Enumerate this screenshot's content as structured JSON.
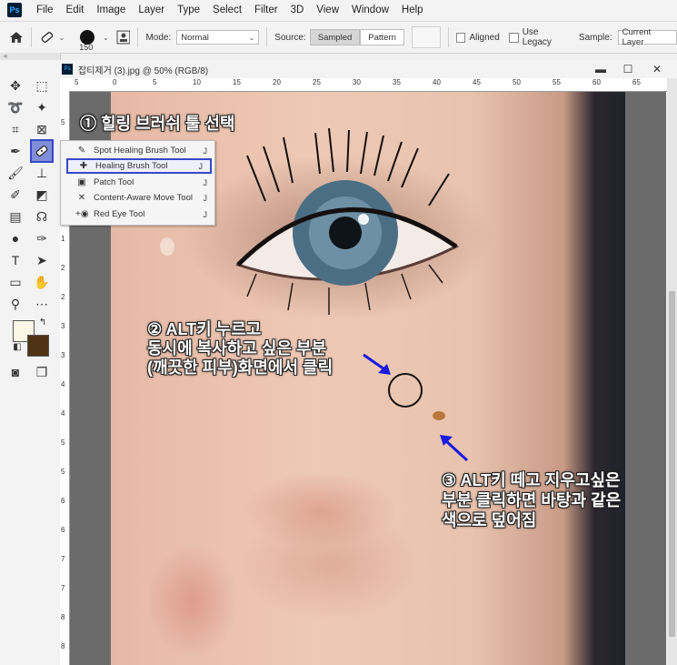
{
  "app": {
    "logo": "Ps"
  },
  "menu": [
    "File",
    "Edit",
    "Image",
    "Layer",
    "Type",
    "Select",
    "Filter",
    "3D",
    "View",
    "Window",
    "Help"
  ],
  "options": {
    "brush_size": "150",
    "mode_label": "Mode:",
    "mode_value": "Normal",
    "source_label": "Source:",
    "source_sampled": "Sampled",
    "source_pattern": "Pattern",
    "aligned": "Aligned",
    "use_legacy": "Use Legacy",
    "sample_label": "Sample:",
    "sample_value": "Current Layer"
  },
  "document": {
    "title": "잡티제거 (3).jpg @ 50% (RGB/8)",
    "win_minimize": "▬",
    "win_restore": "☐",
    "win_close": "✕"
  },
  "ruler_top": [
    "5",
    "0",
    "5",
    "10",
    "15",
    "20",
    "25",
    "30",
    "35",
    "40",
    "45",
    "50",
    "55",
    "60",
    "65"
  ],
  "ruler_left": [
    "5",
    "0",
    "5",
    "1",
    "1",
    "2",
    "2",
    "3",
    "3",
    "4",
    "4",
    "5",
    "5",
    "6",
    "6",
    "7",
    "7",
    "8",
    "8",
    "9",
    "9",
    "1",
    "1",
    "1"
  ],
  "flyout": [
    {
      "icon": "spot-healing-brush-icon",
      "glyph": "✎",
      "label": "Spot Healing Brush Tool",
      "key": "J"
    },
    {
      "icon": "healing-brush-icon",
      "glyph": "✚",
      "label": "Healing Brush Tool",
      "key": "J"
    },
    {
      "icon": "patch-icon",
      "glyph": "▣",
      "label": "Patch Tool",
      "key": "J"
    },
    {
      "icon": "content-aware-move-icon",
      "glyph": "✕",
      "label": "Content-Aware Move Tool",
      "key": "J"
    },
    {
      "icon": "red-eye-icon",
      "glyph": "+◉",
      "label": "Red Eye Tool",
      "key": "J"
    }
  ],
  "annotations": {
    "step1": "① 힐링 브러쉬 툴 선택",
    "step2_line1": "② ALT키 누르고",
    "step2_line2": "동시에 복사하고 싶은 부분",
    "step2_line3": "(깨끗한 피부)화면에서 클릭",
    "step3_line1": "③ ALT키 떼고 지우고싶은",
    "step3_line2": "부분 클릭하면 바탕과 같은",
    "step3_line3": "색으로 덮어짐"
  },
  "colors": {
    "foreground": "#fbf6e6",
    "background": "#503314",
    "highlight": "#3748c9"
  }
}
